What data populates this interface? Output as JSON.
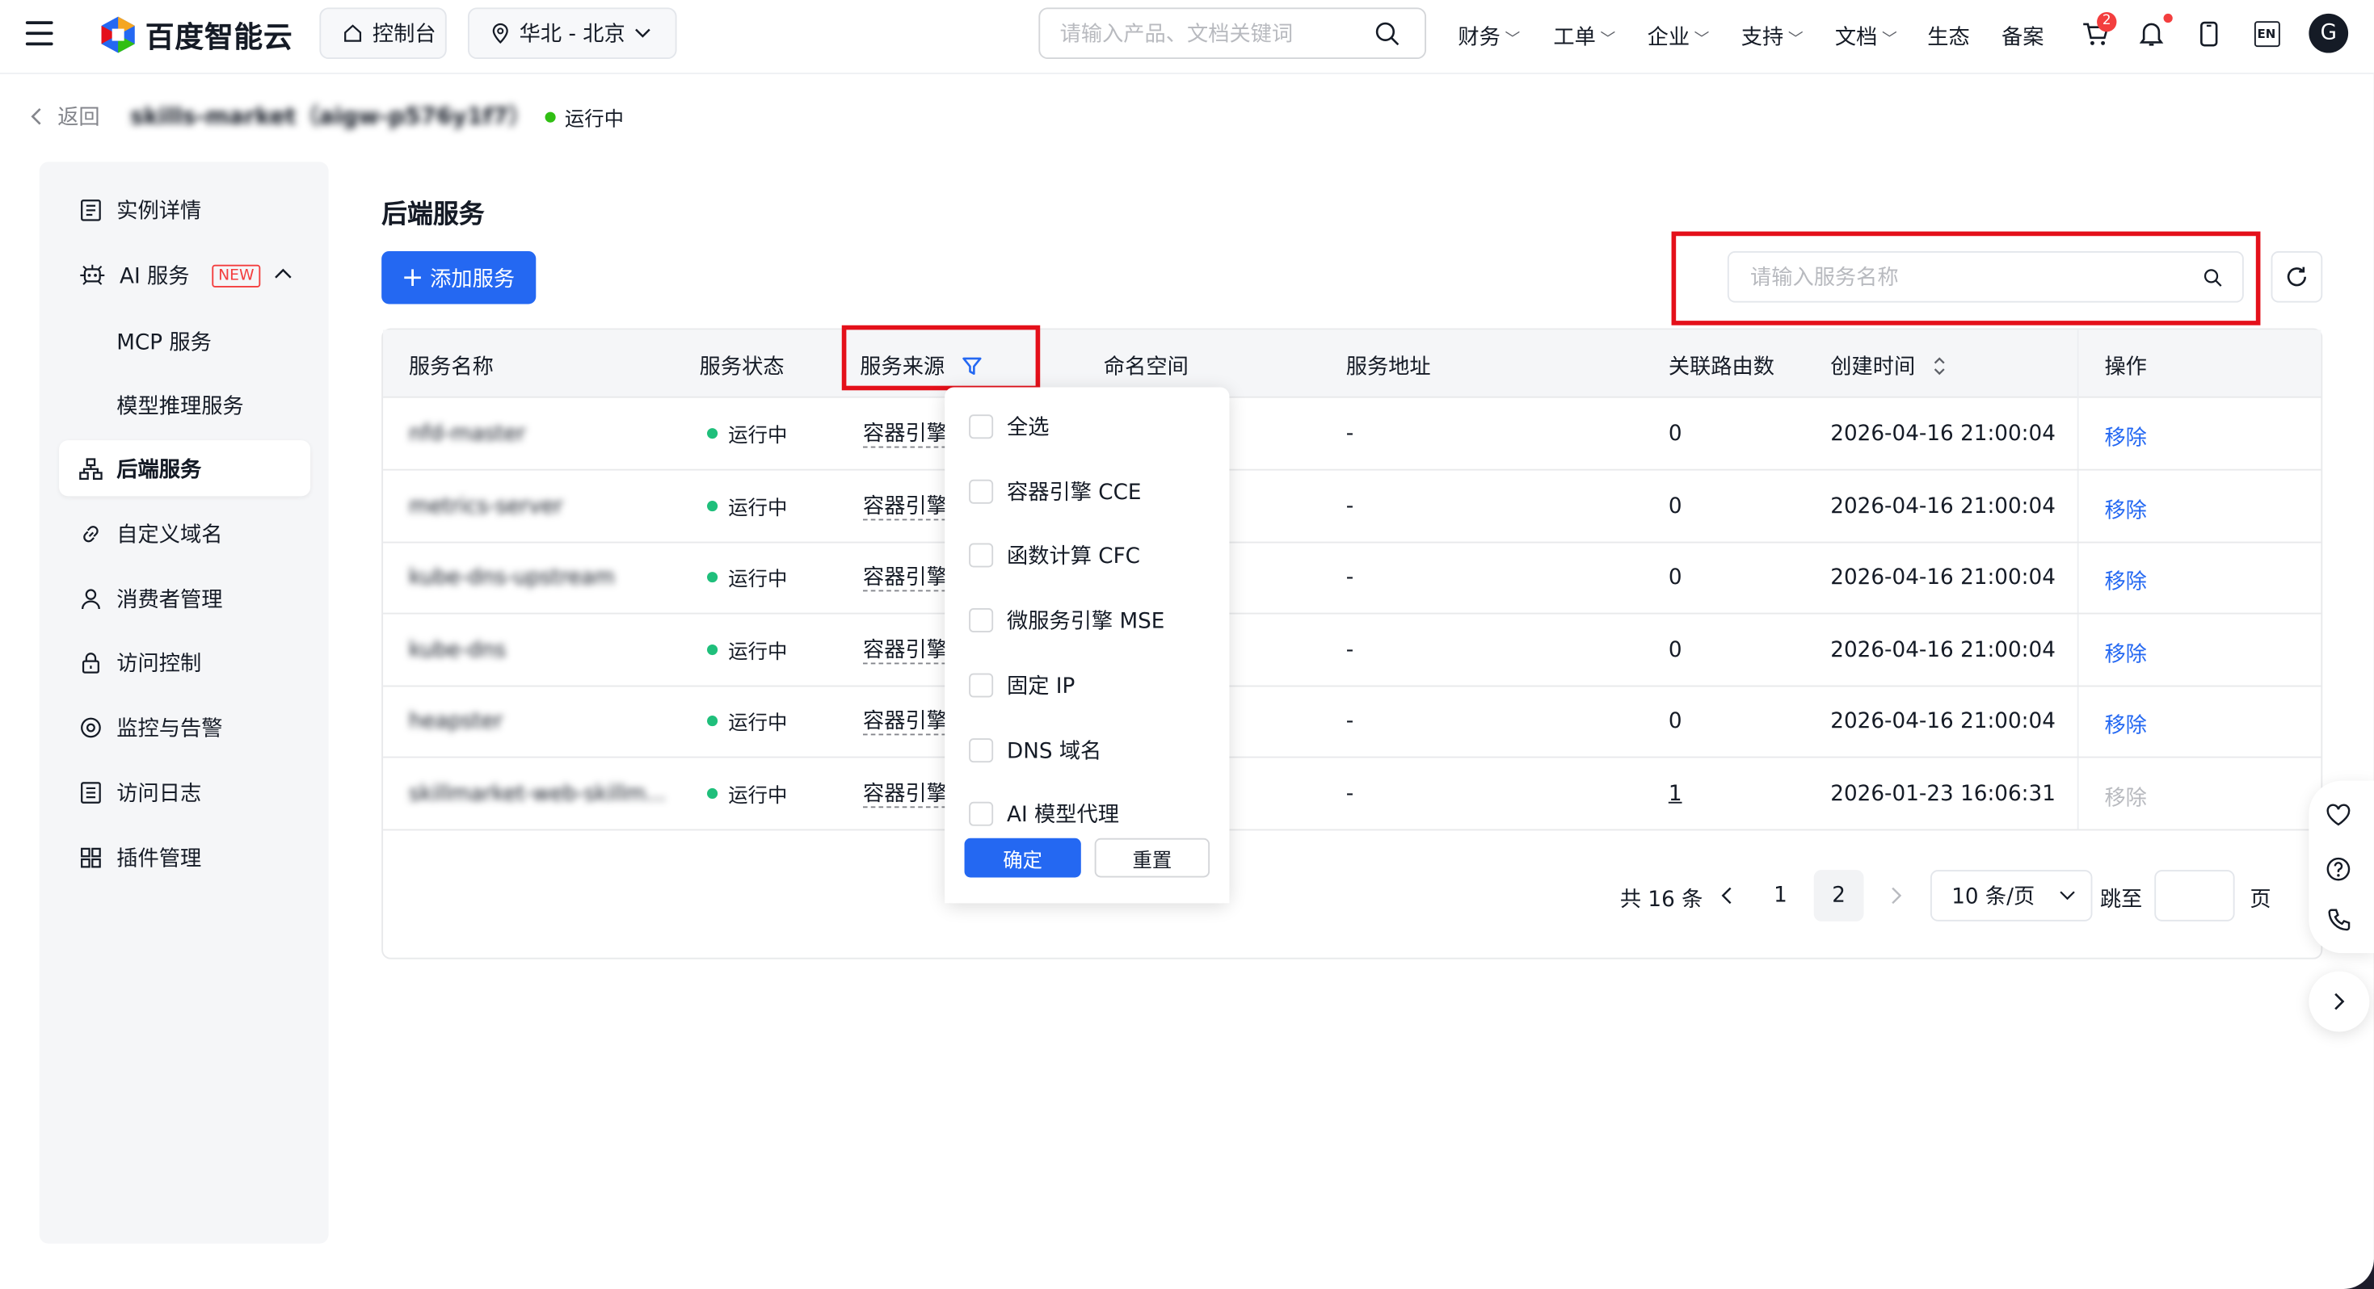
{
  "topbar": {
    "brand": "百度智能云",
    "console": "控制台",
    "region": "华北 - 北京",
    "search_placeholder": "请输入产品、文档关键词",
    "nav": [
      "财务",
      "工单",
      "企业",
      "支持",
      "文档",
      "生态",
      "备案"
    ],
    "cart_badge": "2",
    "lang": "EN",
    "avatar": "G"
  },
  "header": {
    "back": "返回",
    "instance_name": "skills-market（aigw-p576y1f7）",
    "status": "运行中"
  },
  "sidebar": {
    "items": [
      {
        "label": "实例详情",
        "icon": "document-list-icon"
      },
      {
        "label": "AI 服务",
        "icon": "ai-robot-icon",
        "tag": "NEW"
      },
      {
        "label": "MCP 服务"
      },
      {
        "label": "模型推理服务"
      },
      {
        "label": "后端服务",
        "icon": "org-chart-icon"
      },
      {
        "label": "自定义域名",
        "icon": "link-icon"
      },
      {
        "label": "消费者管理",
        "icon": "user-icon"
      },
      {
        "label": "访问控制",
        "icon": "lock-icon"
      },
      {
        "label": "监控与告警",
        "icon": "monitor-icon"
      },
      {
        "label": "访问日志",
        "icon": "log-icon"
      },
      {
        "label": "插件管理",
        "icon": "grid-icon"
      }
    ]
  },
  "main": {
    "title": "后端服务",
    "add_button": "添加服务",
    "search_placeholder": "请输入服务名称",
    "columns": [
      "服务名称",
      "服务状态",
      "服务来源",
      "命名空间",
      "服务地址",
      "关联路由数",
      "创建时间",
      "操作"
    ],
    "rows": [
      {
        "name": "nfd-master",
        "status": "运行中",
        "source": "容器引擎 CCE",
        "namespace": "",
        "address": "-",
        "routes": "0",
        "created": "2026-04-16 21:00:04",
        "action": "移除"
      },
      {
        "name": "metrics-server",
        "status": "运行中",
        "source": "容器引擎 CCE",
        "namespace": "",
        "address": "-",
        "routes": "0",
        "created": "2026-04-16 21:00:04",
        "action": "移除"
      },
      {
        "name": "kube-dns-upstream",
        "status": "运行中",
        "source": "容器引擎 CCE",
        "namespace": "",
        "address": "-",
        "routes": "0",
        "created": "2026-04-16 21:00:04",
        "action": "移除"
      },
      {
        "name": "kube-dns",
        "status": "运行中",
        "source": "容器引擎 CCE",
        "namespace": "",
        "address": "-",
        "routes": "0",
        "created": "2026-04-16 21:00:04",
        "action": "移除"
      },
      {
        "name": "heapster",
        "status": "运行中",
        "source": "容器引擎 CCE",
        "namespace": "",
        "address": "-",
        "routes": "0",
        "created": "2026-04-16 21:00:04",
        "action": "移除"
      },
      {
        "name": "skillmarket-web-skillm...",
        "status": "运行中",
        "source": "容器引擎 CCE",
        "namespace": "",
        "address": "-",
        "routes": "1",
        "created": "2026-01-23 16:06:31",
        "action": "移除"
      }
    ],
    "filter": {
      "options": [
        "全选",
        "容器引擎 CCE",
        "函数计算 CFC",
        "微服务引擎 MSE",
        "固定 IP",
        "DNS 域名",
        "AI 模型代理"
      ],
      "confirm": "确定",
      "reset": "重置"
    },
    "pagination": {
      "total": "共 16 条",
      "pages": [
        "1",
        "2"
      ],
      "current": "2",
      "page_size": "10 条/页",
      "jump_label": "跳至",
      "page_unit": "页"
    }
  },
  "colors": {
    "primary": "#2468f2",
    "running": "#1fbf7b",
    "highlight": "#e4101a"
  }
}
